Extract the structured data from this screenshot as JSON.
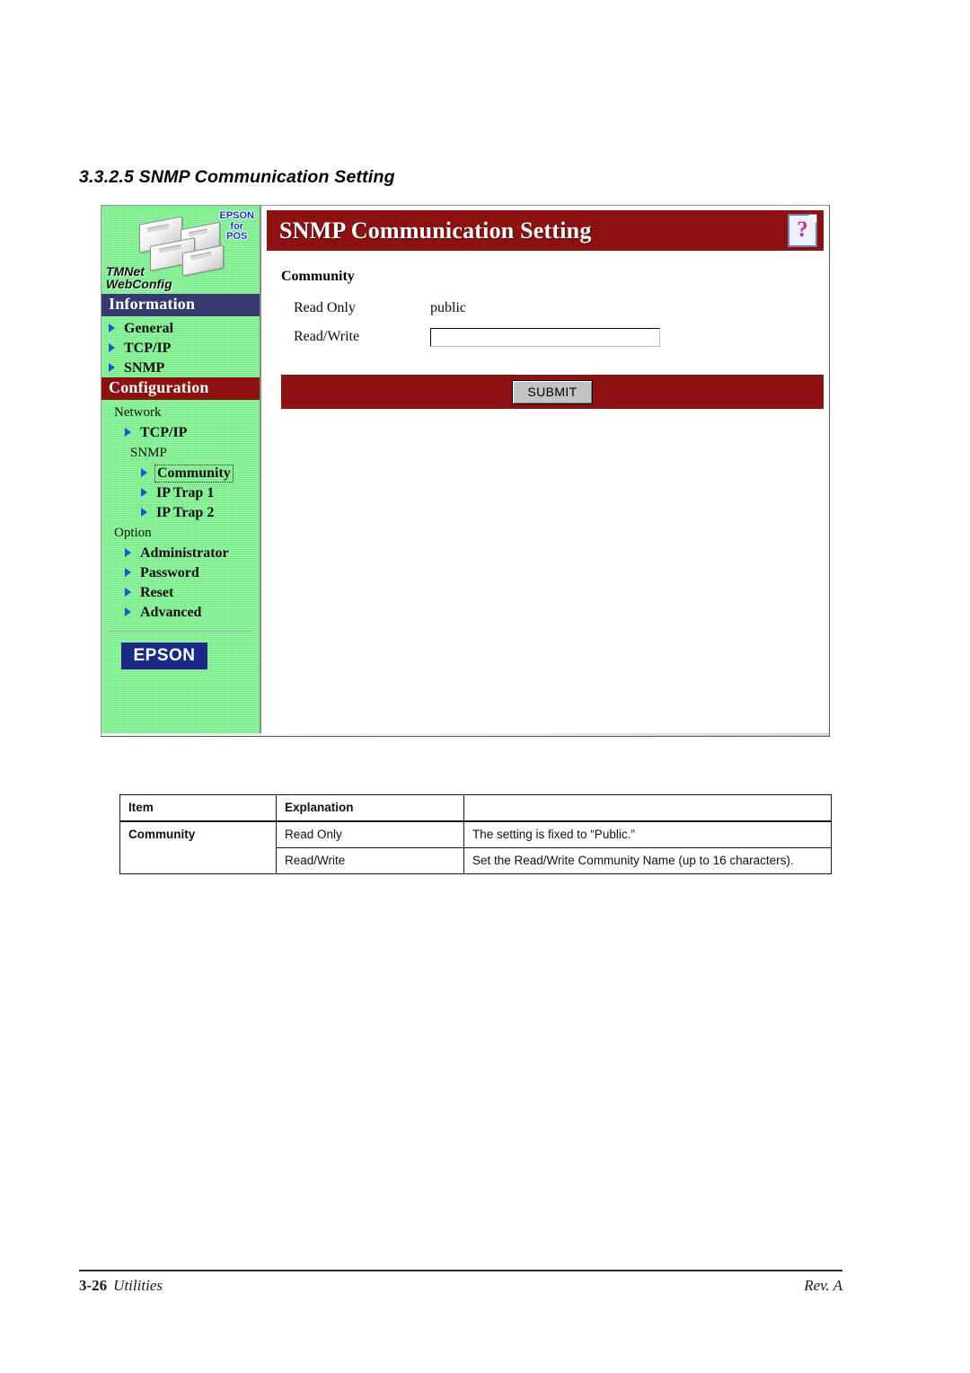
{
  "document": {
    "section_heading": "3.3.2.5 SNMP Communication Setting",
    "footer": {
      "page_number": "3-26",
      "section": "Utilities",
      "revision": "Rev. A"
    }
  },
  "screenshot": {
    "sidebar": {
      "logo": {
        "brand_line1": "TMNet",
        "brand_line2": "WebConfig",
        "tag_line1": "EPSON",
        "tag_line2": "for",
        "tag_line3": "POS"
      },
      "sections": [
        {
          "header": "Information",
          "header_color": "#343a6e",
          "items": [
            {
              "label": "General",
              "level": 1,
              "bullet": true,
              "focused": false
            },
            {
              "label": "TCP/IP",
              "level": 1,
              "bullet": true,
              "focused": false
            },
            {
              "label": "SNMP",
              "level": 1,
              "bullet": true,
              "focused": false
            }
          ]
        },
        {
          "header": "Configuration",
          "header_color": "#8e1111",
          "subheading_network": "Network",
          "subheading_snmp": "SNMP",
          "subheading_option": "Option",
          "items": [
            {
              "label": "TCP/IP",
              "level": 2,
              "bullet": true,
              "focused": false
            },
            {
              "label": "Community",
              "level": 3,
              "bullet": true,
              "focused": true
            },
            {
              "label": "IP Trap 1",
              "level": 3,
              "bullet": true,
              "focused": false
            },
            {
              "label": "IP Trap 2",
              "level": 3,
              "bullet": true,
              "focused": false
            },
            {
              "label": "Administrator",
              "level": 2,
              "bullet": true,
              "focused": false
            },
            {
              "label": "Password",
              "level": 2,
              "bullet": true,
              "focused": false
            },
            {
              "label": "Reset",
              "level": 2,
              "bullet": true,
              "focused": false
            },
            {
              "label": "Advanced",
              "level": 2,
              "bullet": true,
              "focused": false
            }
          ]
        }
      ],
      "footer_logo": "EPSON"
    },
    "main": {
      "banner_title": "SNMP Communication Setting",
      "banner_color": "#8e1111",
      "help_glyph": "?",
      "form": {
        "group_title": "Community",
        "read_only_label": "Read Only",
        "read_only_value": "public",
        "read_write_label": "Read/Write",
        "read_write_value": "",
        "read_write_placeholder": ""
      },
      "submit_label": "SUBMIT"
    }
  },
  "table": {
    "headers": [
      "Item",
      "Explanation",
      ""
    ],
    "rows": [
      {
        "item": "Community",
        "sub": "Read Only",
        "explanation": "The setting is fixed to “Public.”"
      },
      {
        "item": "",
        "sub": "Read/Write",
        "explanation": "Set the Read/Write Community Name (up to 16 characters)."
      }
    ]
  }
}
